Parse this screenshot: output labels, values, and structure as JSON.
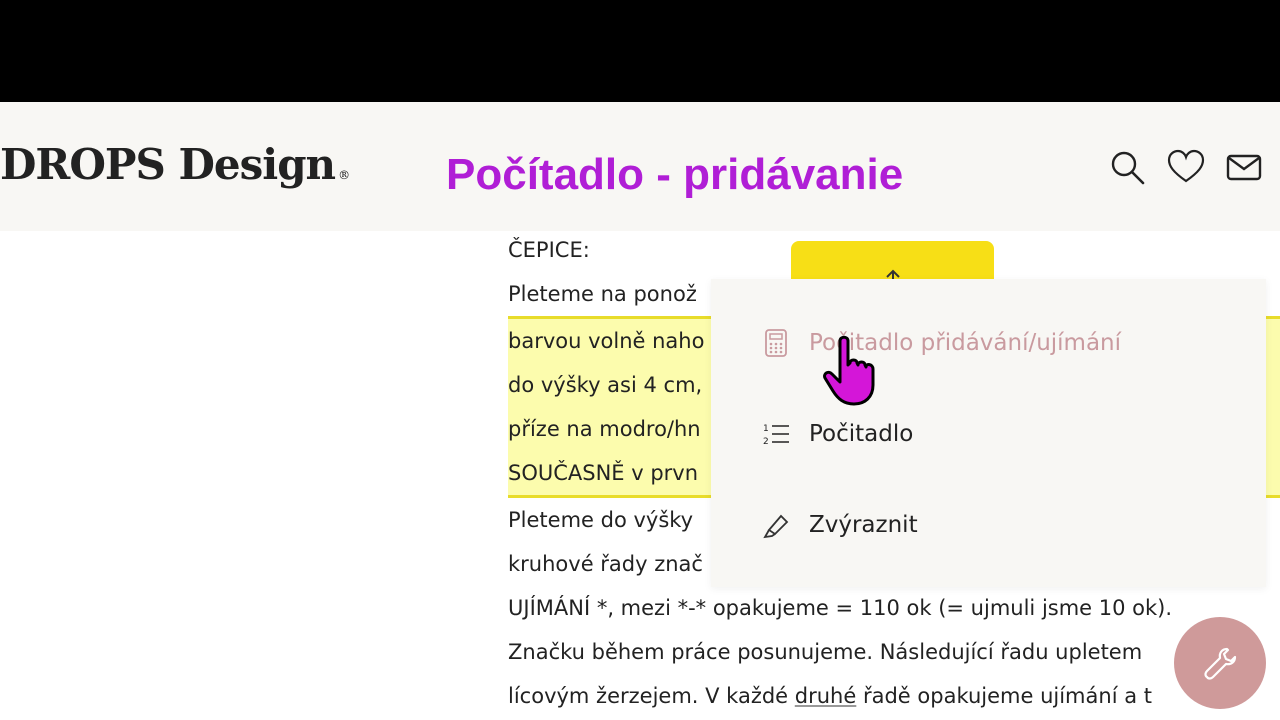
{
  "header": {
    "logo_text": "DROPS Design",
    "logo_mark": "®",
    "title_overlay": "Počítadlo - pridávanie",
    "icons": [
      "search-icon",
      "heart-icon",
      "mail-icon"
    ]
  },
  "content": {
    "lines": [
      "ČEPICE:",
      "Pleteme na ponož",
      "barvou volně naho",
      "do výšky asi 4 cm,",
      "příze na modro/hn",
      "SOUČASNĚ v prvn",
      "Pleteme do výšky",
      "kruhové řady znač",
      "UJÍMÁNÍ *, mezi *-* opakujeme = 110 ok (= ujmuli jsme 10 ok).",
      "Značku během práce posunujeme. Následující řadu upletem",
      "lícovým žerzejem. V každé druhé řadě opakujeme ujímání a t"
    ],
    "underlined_word": "druhé"
  },
  "popup": {
    "items": [
      {
        "label": "Počitadlo přidávání/ujímání",
        "icon": "calculator-icon",
        "active": true
      },
      {
        "label": "Počitadlo",
        "icon": "numbered-list-icon",
        "active": false
      },
      {
        "label": "Zvýraznit",
        "icon": "highlighter-icon",
        "active": false
      }
    ]
  },
  "colors": {
    "title": "#b01ed6",
    "highlight_bg": "#fcfcad",
    "highlight_border": "#e8dc2a",
    "popup_tab": "#f7df16",
    "fab": "#cf9a9a"
  }
}
